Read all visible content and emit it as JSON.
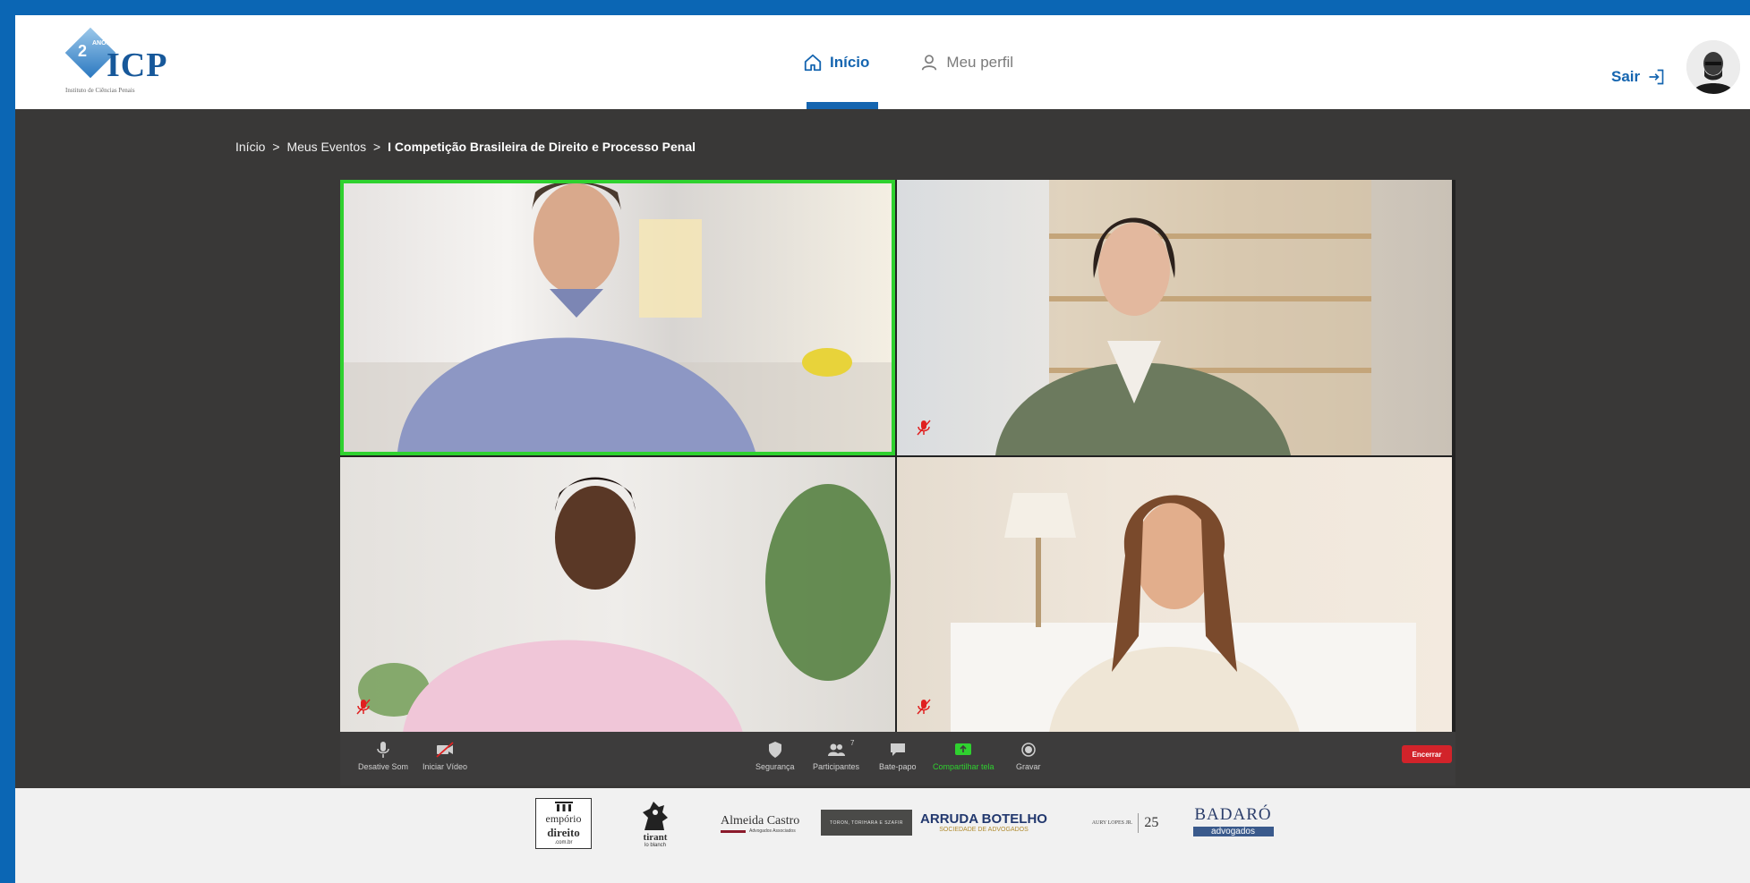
{
  "header": {
    "logo": {
      "badge_number": "2",
      "badge_sup": "ANOS",
      "brand": "ICP",
      "tagline": "Instituto de Ciências Penais"
    },
    "nav": [
      {
        "label": "Início",
        "icon": "home-icon",
        "active": true
      },
      {
        "label": "Meu perfil",
        "icon": "user-icon",
        "active": false
      }
    ],
    "logout_label": "Sair"
  },
  "breadcrumb": {
    "items": [
      "Início",
      "Meus Eventos"
    ],
    "separator": ">",
    "current": "I Competição Brasileira de Direito e Processo Penal"
  },
  "meeting": {
    "active_speaker_color": "#2fd12f",
    "muted_color": "#e02020",
    "toolbar": {
      "mute_label": "Desative Som",
      "video_label": "Iniciar Vídeo",
      "security_label": "Segurança",
      "participants_label": "Participantes",
      "participants_count": "7",
      "chat_label": "Bate-papo",
      "share_label": "Compartilhar tela",
      "record_label": "Gravar",
      "end_label": "Encerrar"
    }
  },
  "sponsors": {
    "emporio": {
      "line1": "empório",
      "line2": "direito",
      "line3": ".com.br"
    },
    "tirant": {
      "line1": "tirant",
      "line2": "lo blanch"
    },
    "almeida": {
      "name": "Almeida Castro",
      "sub": "Advogados Associados"
    },
    "toron": {
      "name": "TORON, TORIHARA E SZAFIR"
    },
    "arruda": {
      "name": "ARRUDA BOTELHO",
      "sub": "SOCIEDADE DE ADVOGADOS"
    },
    "aury": {
      "name": "AURY LOPES JR.",
      "years": "25"
    },
    "badaro": {
      "name": "BADARÓ",
      "sub": "advogados"
    }
  },
  "colors": {
    "brand_blue": "#1565b0",
    "frame_blue": "#0b66b4",
    "dark_bg": "#393837"
  }
}
